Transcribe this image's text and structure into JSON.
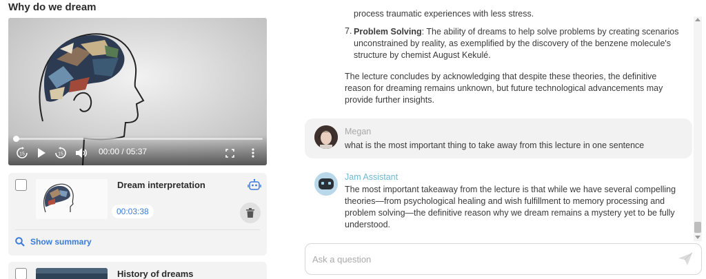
{
  "page": {
    "title": "Why do we dream"
  },
  "player": {
    "current_time": "00:00",
    "separator": "/",
    "total_time": "05:37",
    "skip_back_label": "15",
    "skip_forward_label": "15"
  },
  "videos": [
    {
      "title": "Dream interpretation",
      "duration": "00:03:38",
      "summary_label": "Show summary"
    },
    {
      "title": "History of dreams"
    }
  ],
  "chat": {
    "cut_line": "process traumatic experiences with less stress.",
    "list_item": {
      "number": "7.",
      "term": "Problem Solving",
      "text": ": The ability of dreams to help solve problems by creating scenarios unconstrained by reality, as exemplified by the discovery of the benzene molecule's structure by chemist August Kekulé."
    },
    "conclusion": "The lecture concludes by acknowledging that despite these theories, the definitive reason for dreaming remains unknown, but future technological advancements may provide further insights.",
    "user": {
      "name": "Megan",
      "message": "what is the most important thing to take away from this lecture in one sentence"
    },
    "assistant": {
      "name": "Jam Assistant",
      "message": "The most important takeaway from the lecture is that while we have several compelling theories—from psychological healing and wish fulfillment to memory processing and problem solving—the definitive reason why we dream remains a mystery yet to be fully understood."
    }
  },
  "input": {
    "placeholder": "Ask a question"
  },
  "colors": {
    "accent_blue": "#3b7bd8",
    "assistant_name": "#6fb7d3",
    "user_name": "#a8a8a8",
    "card_bg": "#f3f3f3"
  },
  "icons": [
    "robot-icon",
    "trash-icon",
    "search-icon",
    "send-icon",
    "play-icon",
    "volume-icon",
    "fullscreen-icon",
    "more-vertical-icon"
  ]
}
